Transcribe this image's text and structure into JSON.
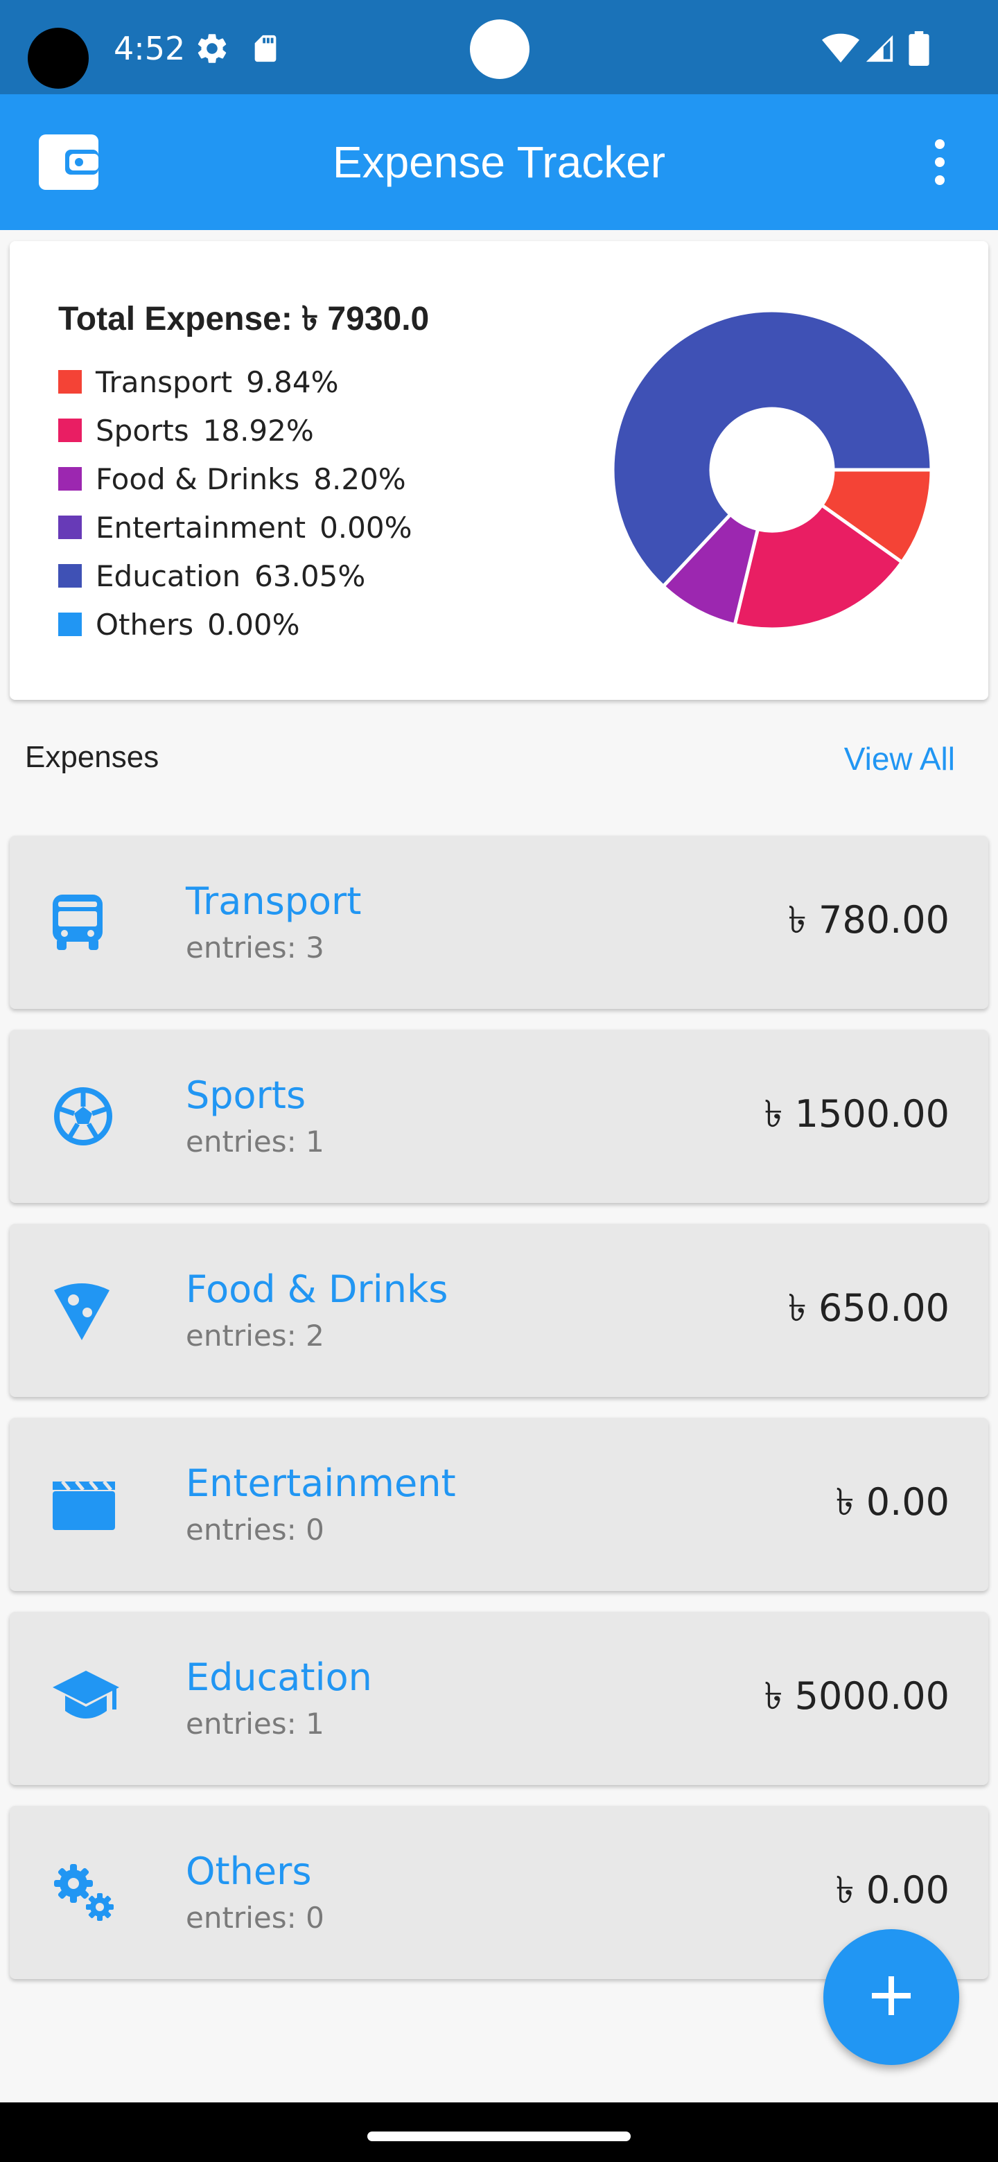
{
  "status_bar": {
    "time": "4:52"
  },
  "app_bar": {
    "title": "Expense Tracker"
  },
  "summary": {
    "total_label": "Total Expense: ৳ 7930.0",
    "legend": [
      {
        "label": "Transport",
        "pct": "9.84%",
        "value": 9.84,
        "color": "#f44336"
      },
      {
        "label": "Sports",
        "pct": "18.92%",
        "value": 18.92,
        "color": "#e91e63"
      },
      {
        "label": "Food & Drinks",
        "pct": "8.20%",
        "value": 8.2,
        "color": "#9c27b0"
      },
      {
        "label": "Entertainment",
        "pct": "0.00%",
        "value": 0.0,
        "color": "#673ab7"
      },
      {
        "label": "Education",
        "pct": "63.05%",
        "value": 63.05,
        "color": "#3f51b5"
      },
      {
        "label": "Others",
        "pct": "0.00%",
        "value": 0.0,
        "color": "#2196f3"
      }
    ]
  },
  "expenses": {
    "header": "Expenses",
    "view_all": "View All",
    "items": [
      {
        "name": "Transport",
        "entries": "entries: 3",
        "amount": "৳ 780.00",
        "icon": "bus-icon"
      },
      {
        "name": "Sports",
        "entries": "entries: 1",
        "amount": "৳ 1500.00",
        "icon": "soccer-ball-icon"
      },
      {
        "name": "Food & Drinks",
        "entries": "entries: 2",
        "amount": "৳ 650.00",
        "icon": "pizza-icon"
      },
      {
        "name": "Entertainment",
        "entries": "entries: 0",
        "amount": "৳ 0.00",
        "icon": "clapperboard-icon"
      },
      {
        "name": "Education",
        "entries": "entries: 1",
        "amount": "৳ 5000.00",
        "icon": "graduation-cap-icon"
      },
      {
        "name": "Others",
        "entries": "entries: 0",
        "amount": "৳ 0.00",
        "icon": "gears-icon"
      }
    ]
  },
  "colors": {
    "primary": "#2196f3",
    "status_bar": "#1a72b8"
  },
  "chart_data": {
    "type": "pie",
    "donut": true,
    "categories": [
      "Transport",
      "Sports",
      "Food & Drinks",
      "Entertainment",
      "Education",
      "Others"
    ],
    "values": [
      9.84,
      18.92,
      8.2,
      0.0,
      63.05,
      0.0
    ]
  }
}
